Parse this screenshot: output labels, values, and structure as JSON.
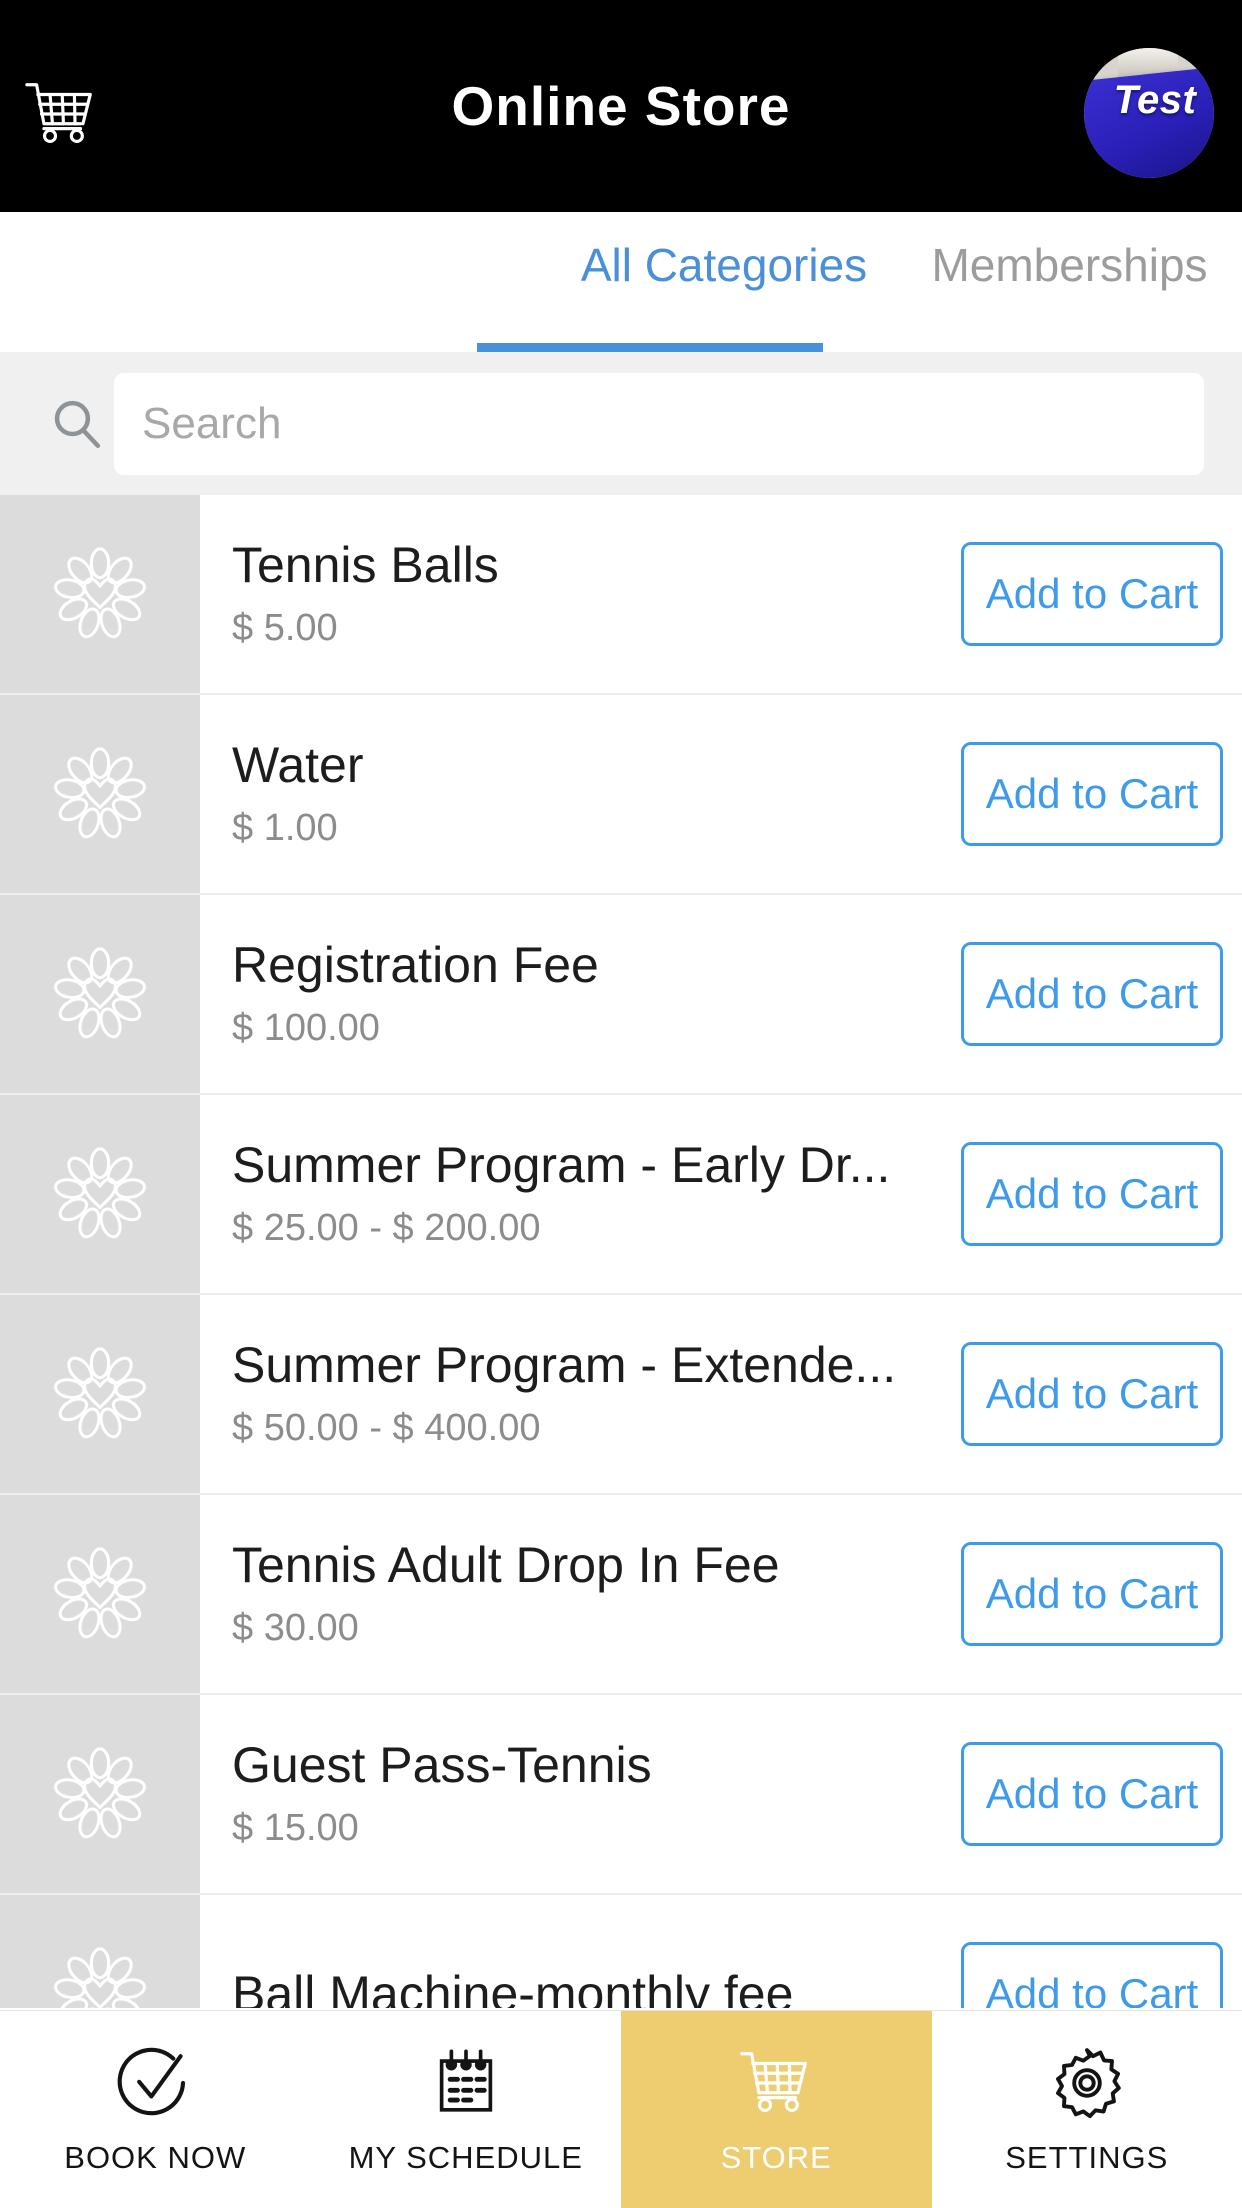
{
  "header": {
    "title": "Online Store",
    "cart_icon": "shopping-cart-icon",
    "avatar_text": "Test"
  },
  "tabs": [
    {
      "label": "All Categories",
      "active": true
    },
    {
      "label": "Memberships",
      "active": false
    }
  ],
  "search": {
    "placeholder": "Search",
    "value": "",
    "icon": "search-icon"
  },
  "products": [
    {
      "name": "Tennis Balls",
      "price": "$ 5.00",
      "action": "Add to Cart"
    },
    {
      "name": "Water",
      "price": "$ 1.00",
      "action": "Add to Cart"
    },
    {
      "name": "Registration Fee",
      "price": "$ 100.00",
      "action": "Add to Cart"
    },
    {
      "name": "Summer Program - Early Dr...",
      "price": "$ 25.00 - $ 200.00",
      "action": "Add to Cart"
    },
    {
      "name": "Summer Program - Extende...",
      "price": "$ 50.00 - $ 400.00",
      "action": "Add to Cart"
    },
    {
      "name": "Tennis Adult Drop In Fee",
      "price": "$ 30.00",
      "action": "Add to Cart"
    },
    {
      "name": "Guest Pass-Tennis",
      "price": "$ 15.00",
      "action": "Add to Cart"
    },
    {
      "name": "Ball Machine-monthly fee",
      "price": "",
      "action": "Add to Cart"
    }
  ],
  "bottom_nav": [
    {
      "label": "BOOK NOW",
      "icon": "check-circle-icon",
      "active": false
    },
    {
      "label": "MY SCHEDULE",
      "icon": "calendar-icon",
      "active": false
    },
    {
      "label": "STORE",
      "icon": "shopping-cart-icon",
      "active": true
    },
    {
      "label": "SETTINGS",
      "icon": "gear-icon",
      "active": false
    }
  ],
  "colors": {
    "header_bg": "#000000",
    "accent_blue": "#4a90d9",
    "button_blue": "#3d9be9",
    "active_nav_bg": "#eecd71",
    "search_bg": "#f0f0f0",
    "thumb_bg": "#dcdcdc"
  }
}
